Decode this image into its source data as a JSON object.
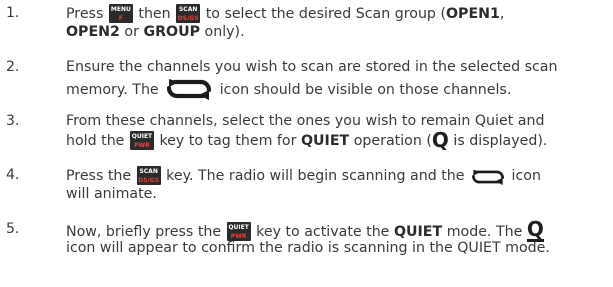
{
  "keys": {
    "menu": {
      "top": "MENU",
      "bottom": "F"
    },
    "scan": {
      "top": "SCAN",
      "bottom": "DS/GS"
    },
    "quiet": {
      "top": "QUIET",
      "bottom": "PWR"
    }
  },
  "icons": {
    "scan_icon": "scan-loop-arrows-icon",
    "quiet_q": "Q"
  },
  "colors": {
    "key_bg": "#2b2b2b",
    "key_top": "#ffffff",
    "key_bottom": "#e8403a",
    "text": "#3a3a3a"
  },
  "steps": [
    {
      "num": "1.",
      "p1": "Press",
      "p2": "then",
      "p3": "to select the desired Scan group (",
      "open1": "OPEN1",
      "comma": ",",
      "open2": "OPEN2",
      "or": "or",
      "group": "GROUP",
      "only": "only)."
    },
    {
      "num": "2.",
      "l1": "Ensure the channels you wish to scan are stored in the selected scan",
      "l2a": "memory. The",
      "l2b": "icon should be visible on those channels."
    },
    {
      "num": "3.",
      "l1": "From these channels, select the ones you wish to remain Quiet and",
      "l2a": "hold the",
      "l2b": "key to tag them for",
      "quiet": "QUIET",
      "l2c": "operation (",
      "l2d": "is displayed)."
    },
    {
      "num": "4.",
      "l1a": "Press the",
      "l1b": "key. The radio will begin scanning and the",
      "l1c": "icon",
      "l2": "will animate."
    },
    {
      "num": "5.",
      "l1a": "Now, briefly press the",
      "l1b": "key to activate the",
      "quiet": "QUIET",
      "l1c": "mode. The",
      "l2": "icon will appear to confirm the radio is scanning in the QUIET mode."
    }
  ]
}
